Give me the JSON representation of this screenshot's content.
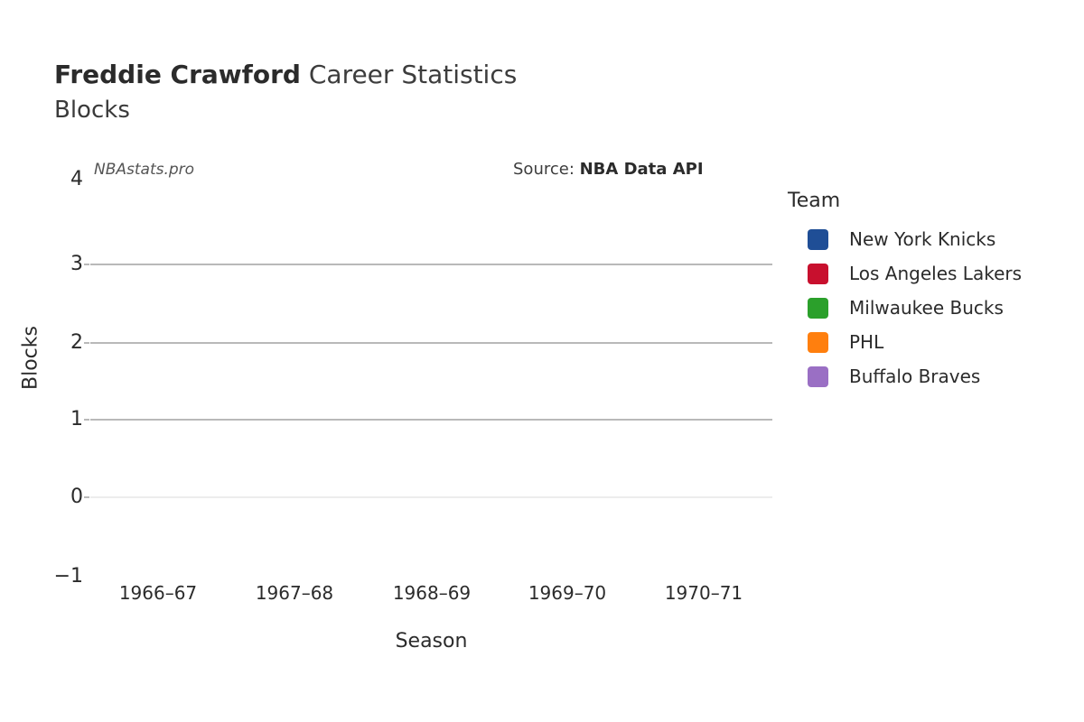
{
  "header": {
    "title_player": "Freddie Crawford",
    "title_rest": " Career Statistics",
    "subtitle": "Blocks"
  },
  "annotations": {
    "watermark": "NBAstats.pro",
    "source_label": "Source: ",
    "source_value": "NBA Data API"
  },
  "legend": {
    "title": "Team",
    "items": [
      {
        "label": "New York Knicks",
        "color": "#1f4e96"
      },
      {
        "label": "Los Angeles Lakers",
        "color": "#c8102e"
      },
      {
        "label": "Milwaukee Bucks",
        "color": "#2ba02b"
      },
      {
        "label": "PHL",
        "color": "#ff7f0e"
      },
      {
        "label": "Buffalo Braves",
        "color": "#9a6fc4"
      }
    ]
  },
  "chart_data": {
    "type": "bar",
    "title": "Freddie Crawford Career Statistics",
    "subtitle": "Blocks",
    "xlabel": "Season",
    "ylabel": "Blocks",
    "categories": [
      "1966–67",
      "1967–68",
      "1968–69",
      "1969–70",
      "1970–71"
    ],
    "series": [
      {
        "name": "New York Knicks",
        "color": "#1f4e96",
        "values": [
          0,
          0,
          0,
          0,
          0
        ]
      },
      {
        "name": "Los Angeles Lakers",
        "color": "#c8102e",
        "values": [
          0,
          0,
          0,
          0,
          0
        ]
      },
      {
        "name": "Milwaukee Bucks",
        "color": "#2ba02b",
        "values": [
          0,
          0,
          0,
          0,
          0
        ]
      },
      {
        "name": "PHL",
        "color": "#ff7f0e",
        "values": [
          0,
          0,
          0,
          0,
          0
        ]
      },
      {
        "name": "Buffalo Braves",
        "color": "#9a6fc4",
        "values": [
          0,
          0,
          0,
          0,
          0
        ]
      }
    ],
    "ylim": [
      -1,
      4
    ],
    "yticks": [
      -1,
      0,
      1,
      2,
      3,
      4
    ],
    "ytick_labels": [
      "−1",
      "0",
      "1",
      "2",
      "3",
      "4"
    ],
    "xtick_labels": [
      "1966–67",
      "1967–68",
      "1968–69",
      "1969–70",
      "1970–71"
    ],
    "grid": "horizontal",
    "legend_position": "right",
    "legend_title": "Team",
    "note": "No bars rendered — all block totals are zero/unavailable for every season."
  },
  "axes": {
    "ytick_labels": [
      "4",
      "3",
      "2",
      "1",
      "0",
      "−1"
    ],
    "xtick_labels": [
      "1966–67",
      "1967–68",
      "1968–69",
      "1969–70",
      "1970–71"
    ],
    "xlabel": "Season",
    "ylabel": "Blocks"
  }
}
